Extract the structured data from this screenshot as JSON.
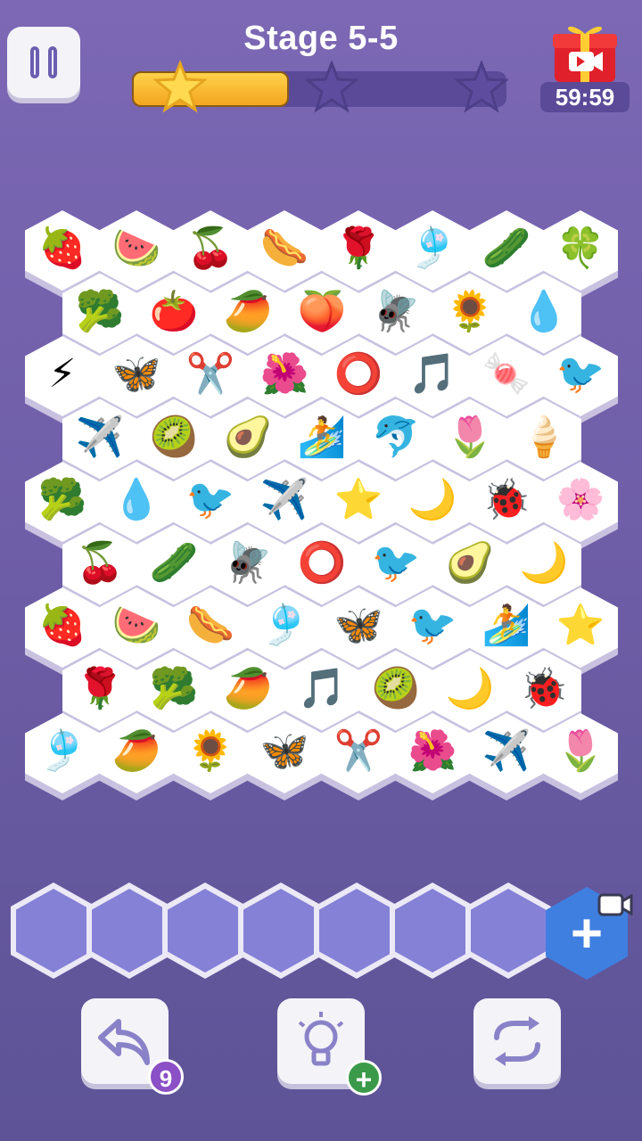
{
  "header": {
    "title": "Stage 5-5",
    "progress": 0.42,
    "timer": "59:59",
    "stars_earned": 1,
    "stars_total": 3
  },
  "colors": {
    "bg_top": "#7c68b4",
    "bg_bottom": "#5d5396",
    "accent_purple": "#6b5db0",
    "slot_fill": "#8581d6",
    "add_button": "#3f7fe0",
    "undo_badge": "#8b4fc6",
    "hint_badge": "#3b9a49"
  },
  "board": {
    "rows": [
      [
        "🍓",
        "🍉",
        "🍒",
        "🌭",
        "🌹",
        "🎐",
        "🥒",
        "🍀"
      ],
      [
        "🥦",
        "🍅",
        "🥭",
        "🍑",
        "🪰",
        "🌻",
        "💧"
      ],
      [
        "⚡",
        "🦋",
        "✂️",
        "🌺",
        "⭕",
        "🎵",
        "🍬",
        "🐦"
      ],
      [
        "✈️",
        "🥝",
        "🥑",
        "🏄",
        "🐬",
        "🌷",
        "🍦"
      ],
      [
        "🥦",
        "💧",
        "🐦",
        "✈️",
        "⭐",
        "🌙",
        "🐞",
        "🌸"
      ],
      [
        "🍒",
        "🥒",
        "🪰",
        "⭕",
        "🐦",
        "🥑",
        "🌙"
      ],
      [
        "🍓",
        "🍉",
        "🌭",
        "🎐",
        "🦋",
        "🐦",
        "🏄",
        "⭐"
      ],
      [
        "🌹",
        "🥦",
        "🥭",
        "🎵",
        "🥝",
        "🌙",
        "🐞"
      ],
      [
        "🎐",
        "🥭",
        "🌻",
        "🦋",
        "✂️",
        "🌺",
        "✈️",
        "🌷"
      ]
    ]
  },
  "tray": {
    "slot_count": 7,
    "add_icon": "plus-icon"
  },
  "tools": {
    "undo_count": "9",
    "hint_badge": "+",
    "undo_icon": "undo-arrow-icon",
    "hint_icon": "lightbulb-icon",
    "shuffle_icon": "shuffle-icon"
  }
}
